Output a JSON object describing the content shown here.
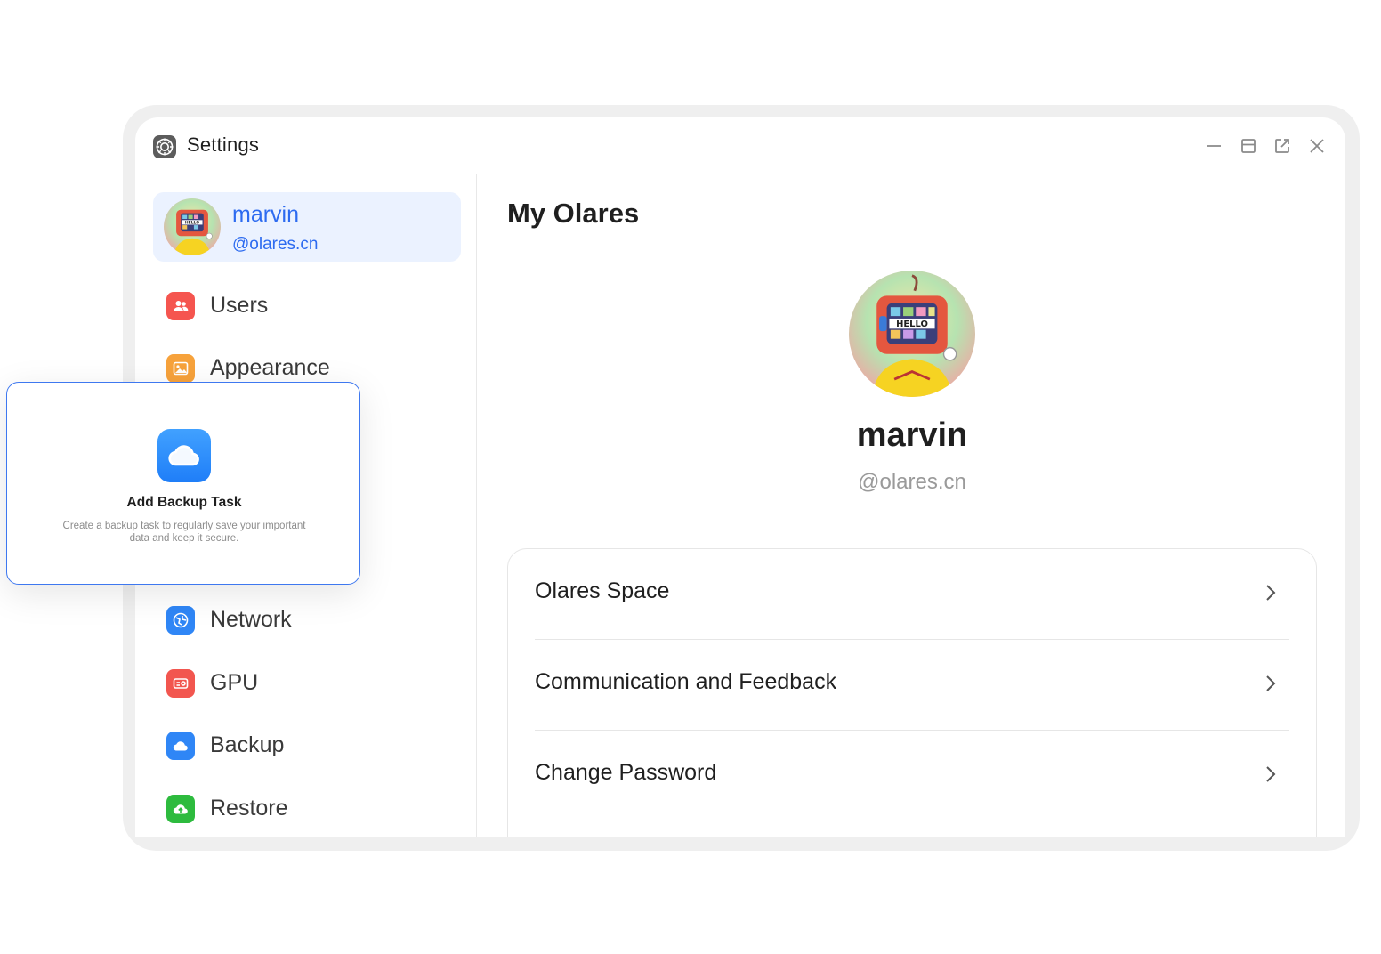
{
  "window": {
    "title": "Settings",
    "controls": [
      "minimize-icon",
      "layout-icon",
      "open-external-icon",
      "close-icon"
    ]
  },
  "sidebar": {
    "profile": {
      "name": "marvin",
      "domain": "@olares.cn",
      "avatar_badge": "HELLO"
    },
    "items": [
      {
        "label": "Users",
        "icon": "users-icon",
        "color": "#f5554f"
      },
      {
        "label": "Appearance",
        "icon": "image-icon",
        "color": "#f7a23b"
      },
      {
        "label": "Network",
        "icon": "network-icon",
        "color": "#2f86f6"
      },
      {
        "label": "GPU",
        "icon": "gpu-icon",
        "color": "#f2564f"
      },
      {
        "label": "Backup",
        "icon": "cloud-icon",
        "color": "#2f86f6"
      },
      {
        "label": "Restore",
        "icon": "cloud-upload-icon",
        "color": "#2dbb3e"
      }
    ]
  },
  "main": {
    "title": "My Olares",
    "user": {
      "name": "marvin",
      "domain": "@olares.cn",
      "avatar_badge": "HELLO"
    },
    "menu": [
      {
        "label": "Olares Space"
      },
      {
        "label": "Communication and Feedback"
      },
      {
        "label": "Change Password"
      }
    ]
  },
  "popup": {
    "title": "Add Backup Task",
    "description": "Create a backup task to regularly save your important data and keep it secure.",
    "icon": "cloud-icon"
  },
  "colors": {
    "accent": "#2d6bf0",
    "active_bg": "#ebf2ff",
    "popup_border": "#3e78f0"
  }
}
